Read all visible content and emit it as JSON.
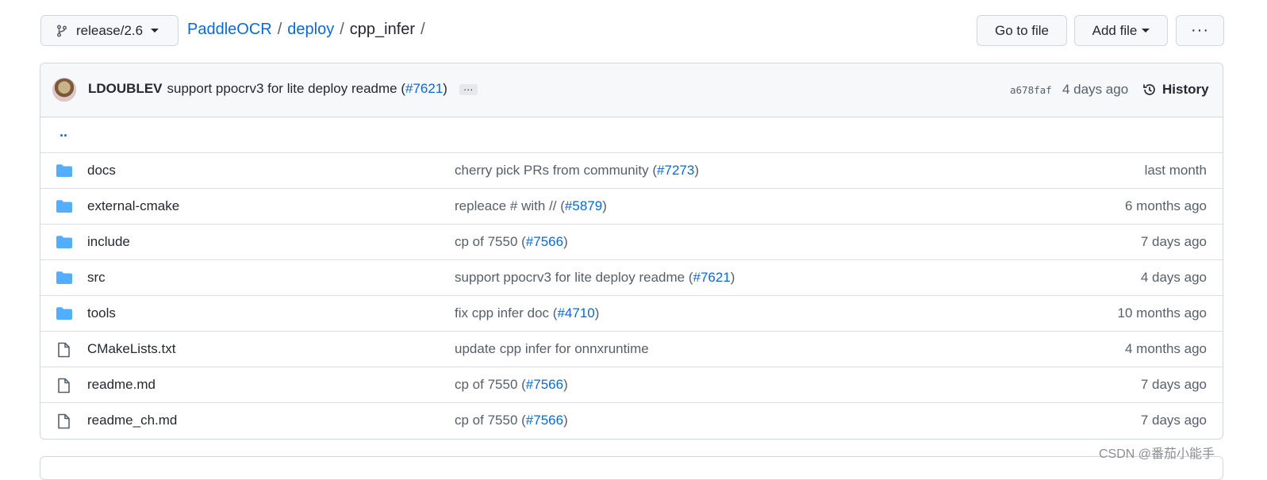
{
  "branch": {
    "label": "release/2.6"
  },
  "breadcrumb": {
    "repo": "PaddleOCR",
    "dir": "deploy",
    "current": "cpp_infer",
    "sep": "/"
  },
  "actions": {
    "goto_file": "Go to file",
    "add_file": "Add file",
    "more": "···"
  },
  "latest_commit": {
    "author": "LDOUBLEV",
    "message": "support ppocrv3 for lite deploy readme (",
    "pr": "#7621",
    "message_end": ")",
    "ellipsis": "…",
    "sha": "a678faf",
    "time": "4 days ago",
    "history_label": "History"
  },
  "parent_link": "..",
  "files": [
    {
      "type": "dir",
      "name": "docs",
      "msg": "cherry pick PRs from community (",
      "pr": "#7273",
      "msg_end": ")",
      "age": "last month"
    },
    {
      "type": "dir",
      "name": "external-cmake",
      "msg": "repleace # with // (",
      "pr": "#5879",
      "msg_end": ")",
      "age": "6 months ago"
    },
    {
      "type": "dir",
      "name": "include",
      "msg": "cp of 7550 (",
      "pr": "#7566",
      "msg_end": ")",
      "age": "7 days ago"
    },
    {
      "type": "dir",
      "name": "src",
      "msg": "support ppocrv3 for lite deploy readme (",
      "pr": "#7621",
      "msg_end": ")",
      "age": "4 days ago"
    },
    {
      "type": "dir",
      "name": "tools",
      "msg": "fix cpp infer doc (",
      "pr": "#4710",
      "msg_end": ")",
      "age": "10 months ago"
    },
    {
      "type": "file",
      "name": "CMakeLists.txt",
      "msg": "update cpp infer for onnxruntime",
      "pr": "",
      "msg_end": "",
      "age": "4 months ago"
    },
    {
      "type": "file",
      "name": "readme.md",
      "msg": "cp of 7550 (",
      "pr": "#7566",
      "msg_end": ")",
      "age": "7 days ago"
    },
    {
      "type": "file",
      "name": "readme_ch.md",
      "msg": "cp of 7550 (",
      "pr": "#7566",
      "msg_end": ")",
      "age": "7 days ago"
    }
  ],
  "watermark": "CSDN @番茄小能手",
  "colors": {
    "link": "#0969da",
    "folder": "#54aeff",
    "muted": "#57606a",
    "border": "#d0d7de"
  }
}
